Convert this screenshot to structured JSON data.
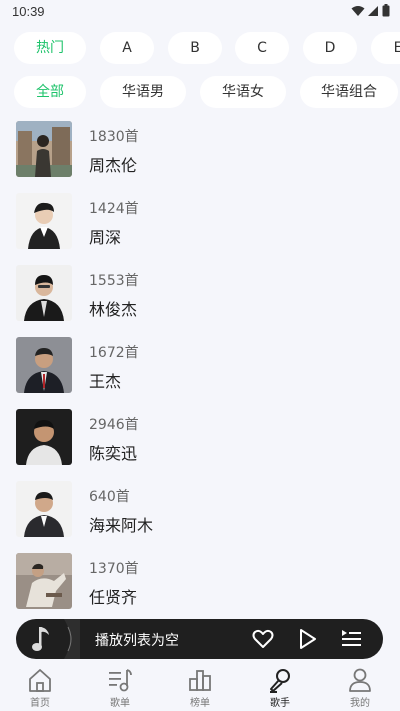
{
  "status_bar": {
    "time": "10:39",
    "icons": [
      "wifi-icon",
      "signal-icon",
      "battery-icon"
    ]
  },
  "filters": {
    "letters": [
      "热门",
      "A",
      "B",
      "C",
      "D",
      "E"
    ],
    "categories": [
      "全部",
      "华语男",
      "华语女",
      "华语组合"
    ],
    "active_letter": "热门",
    "active_category": "全部"
  },
  "artists": [
    {
      "count": "1830首",
      "name": "周杰伦"
    },
    {
      "count": "1424首",
      "name": "周深"
    },
    {
      "count": "1553首",
      "name": "林俊杰"
    },
    {
      "count": "1672首",
      "name": "王杰"
    },
    {
      "count": "2946首",
      "name": "陈奕迅"
    },
    {
      "count": "640首",
      "name": "海来阿木"
    },
    {
      "count": "1370首",
      "name": "任贤齐"
    }
  ],
  "player": {
    "status": "播放列表为空",
    "icons": [
      "music-note-icon",
      "heart-icon",
      "play-icon",
      "playlist-icon"
    ]
  },
  "nav": {
    "items": [
      "首页",
      "歌单",
      "榜单",
      "歌手",
      "我的"
    ],
    "active": "歌手"
  },
  "colors": {
    "accent": "#1fc36b",
    "background": "#f5f6fb",
    "player_bg": "#1f1f1f"
  }
}
